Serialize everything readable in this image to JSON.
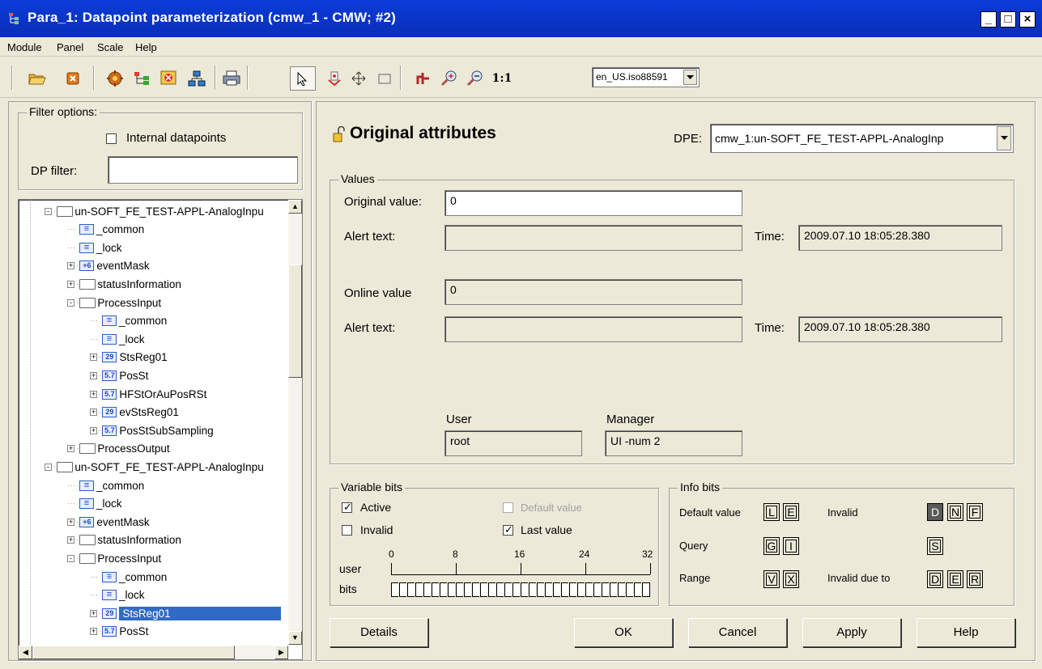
{
  "window": {
    "title": "Para_1: Datapoint parameterization (cmw_1 - CMW; #2)",
    "btn_min": "_",
    "btn_max": "□",
    "btn_close": "×"
  },
  "menu": [
    "Module",
    "Panel",
    "Scale",
    "Help"
  ],
  "toolbar": {
    "icons": [
      "open-folder-icon",
      "close-icon",
      "gear-icon",
      "tree-icon",
      "config-icon",
      "network-icon",
      "print-icon",
      "pointer-icon",
      "cursor-icon",
      "move-icon",
      "rect-icon",
      "target-icon",
      "zoom-in-icon",
      "zoom-out-icon"
    ],
    "zoom_label": "1:1",
    "locale": "en_US.iso88591"
  },
  "filter": {
    "legend": "Filter options:",
    "internal_label": "Internal datapoints",
    "dp_filter_label": "DP filter:",
    "dp_filter_value": ""
  },
  "tree": [
    {
      "depth": 0,
      "type": "folder",
      "state": "-",
      "label": "un-SOFT_FE_TEST-APPL-AnalogInpu"
    },
    {
      "depth": 1,
      "type": "leaf",
      "tag": "E",
      "label": "_common"
    },
    {
      "depth": 1,
      "type": "leaf",
      "tag": "E",
      "label": "_lock"
    },
    {
      "depth": 1,
      "type": "leaf",
      "state": "+",
      "tag": "+6",
      "label": "eventMask"
    },
    {
      "depth": 1,
      "type": "folder",
      "state": "+",
      "label": "statusInformation"
    },
    {
      "depth": 1,
      "type": "folder",
      "state": "-",
      "label": "ProcessInput"
    },
    {
      "depth": 2,
      "type": "leaf",
      "tag": "E",
      "label": "_common"
    },
    {
      "depth": 2,
      "type": "leaf",
      "tag": "E",
      "label": "_lock"
    },
    {
      "depth": 2,
      "type": "leaf",
      "state": "+",
      "tag": "29",
      "label": "StsReg01"
    },
    {
      "depth": 2,
      "type": "leaf",
      "state": "+",
      "tag": "5.7",
      "label": "PosSt"
    },
    {
      "depth": 2,
      "type": "leaf",
      "state": "+",
      "tag": "5.7",
      "label": "HFStOrAuPosRSt"
    },
    {
      "depth": 2,
      "type": "leaf",
      "state": "+",
      "tag": "29",
      "label": "evStsReg01"
    },
    {
      "depth": 2,
      "type": "leaf",
      "state": "+",
      "tag": "5.7",
      "label": "PosStSubSampling"
    },
    {
      "depth": 1,
      "type": "folder",
      "state": "+",
      "label": "ProcessOutput"
    },
    {
      "depth": 0,
      "type": "folder",
      "state": "-",
      "label": "un-SOFT_FE_TEST-APPL-AnalogInpu"
    },
    {
      "depth": 1,
      "type": "leaf",
      "tag": "E",
      "label": "_common"
    },
    {
      "depth": 1,
      "type": "leaf",
      "tag": "E",
      "label": "_lock"
    },
    {
      "depth": 1,
      "type": "leaf",
      "state": "+",
      "tag": "+6",
      "label": "eventMask"
    },
    {
      "depth": 1,
      "type": "folder",
      "state": "+",
      "label": "statusInformation"
    },
    {
      "depth": 1,
      "type": "folder",
      "state": "-",
      "label": "ProcessInput"
    },
    {
      "depth": 2,
      "type": "leaf",
      "tag": "E",
      "label": "_common"
    },
    {
      "depth": 2,
      "type": "leaf",
      "tag": "E",
      "label": "_lock"
    },
    {
      "depth": 2,
      "type": "leaf",
      "state": "+",
      "tag": "29",
      "label": "StsReg01",
      "selected": true
    },
    {
      "depth": 2,
      "type": "leaf",
      "state": "+",
      "tag": "5.7",
      "label": "PosSt"
    }
  ],
  "panel": {
    "heading": "Original attributes",
    "dpe_label": "DPE:",
    "dpe_value": "cmw_1:un-SOFT_FE_TEST-APPL-AnalogInp",
    "values_legend": "Values",
    "original_value_label": "Original value:",
    "original_value": "0",
    "alert_text_label_1": "Alert text:",
    "alert_text_1": "",
    "time_label_1": "Time:",
    "time_1": "2009.07.10 18:05:28.380",
    "online_value_label": "Online value",
    "online_value": "0",
    "alert_text_label_2": "Alert text:",
    "alert_text_2": "",
    "time_label_2": "Time:",
    "time_2": "2009.07.10 18:05:28.380",
    "user_label": "User",
    "user": "root",
    "manager_label": "Manager",
    "manager": "UI -num 2"
  },
  "variable_bits": {
    "legend": "Variable bits",
    "active_label": "Active",
    "active": true,
    "default_label": "Default value",
    "invalid_label": "Invalid",
    "last_value_label": "Last value",
    "last_value": true,
    "user_label": "user",
    "bits_label": "bits",
    "scale": [
      "0",
      "8",
      "16",
      "24",
      "32"
    ]
  },
  "info_bits": {
    "legend": "Info bits",
    "default_value_label": "Default value",
    "invalid_label": "Invalid",
    "query_label": "Query",
    "range_label": "Range",
    "invalid_due_label": "Invalid due to",
    "b_L": "L",
    "b_E": "E",
    "b_D": "D",
    "b_N": "N",
    "b_F": "F",
    "b_G": "G",
    "b_I": "I",
    "b_S": "S",
    "b_V": "V",
    "b_X": "X",
    "b_D2": "D",
    "b_E2": "E",
    "b_R": "R"
  },
  "buttons": {
    "details": "Details",
    "ok": "OK",
    "cancel": "Cancel",
    "apply": "Apply",
    "help": "Help"
  }
}
